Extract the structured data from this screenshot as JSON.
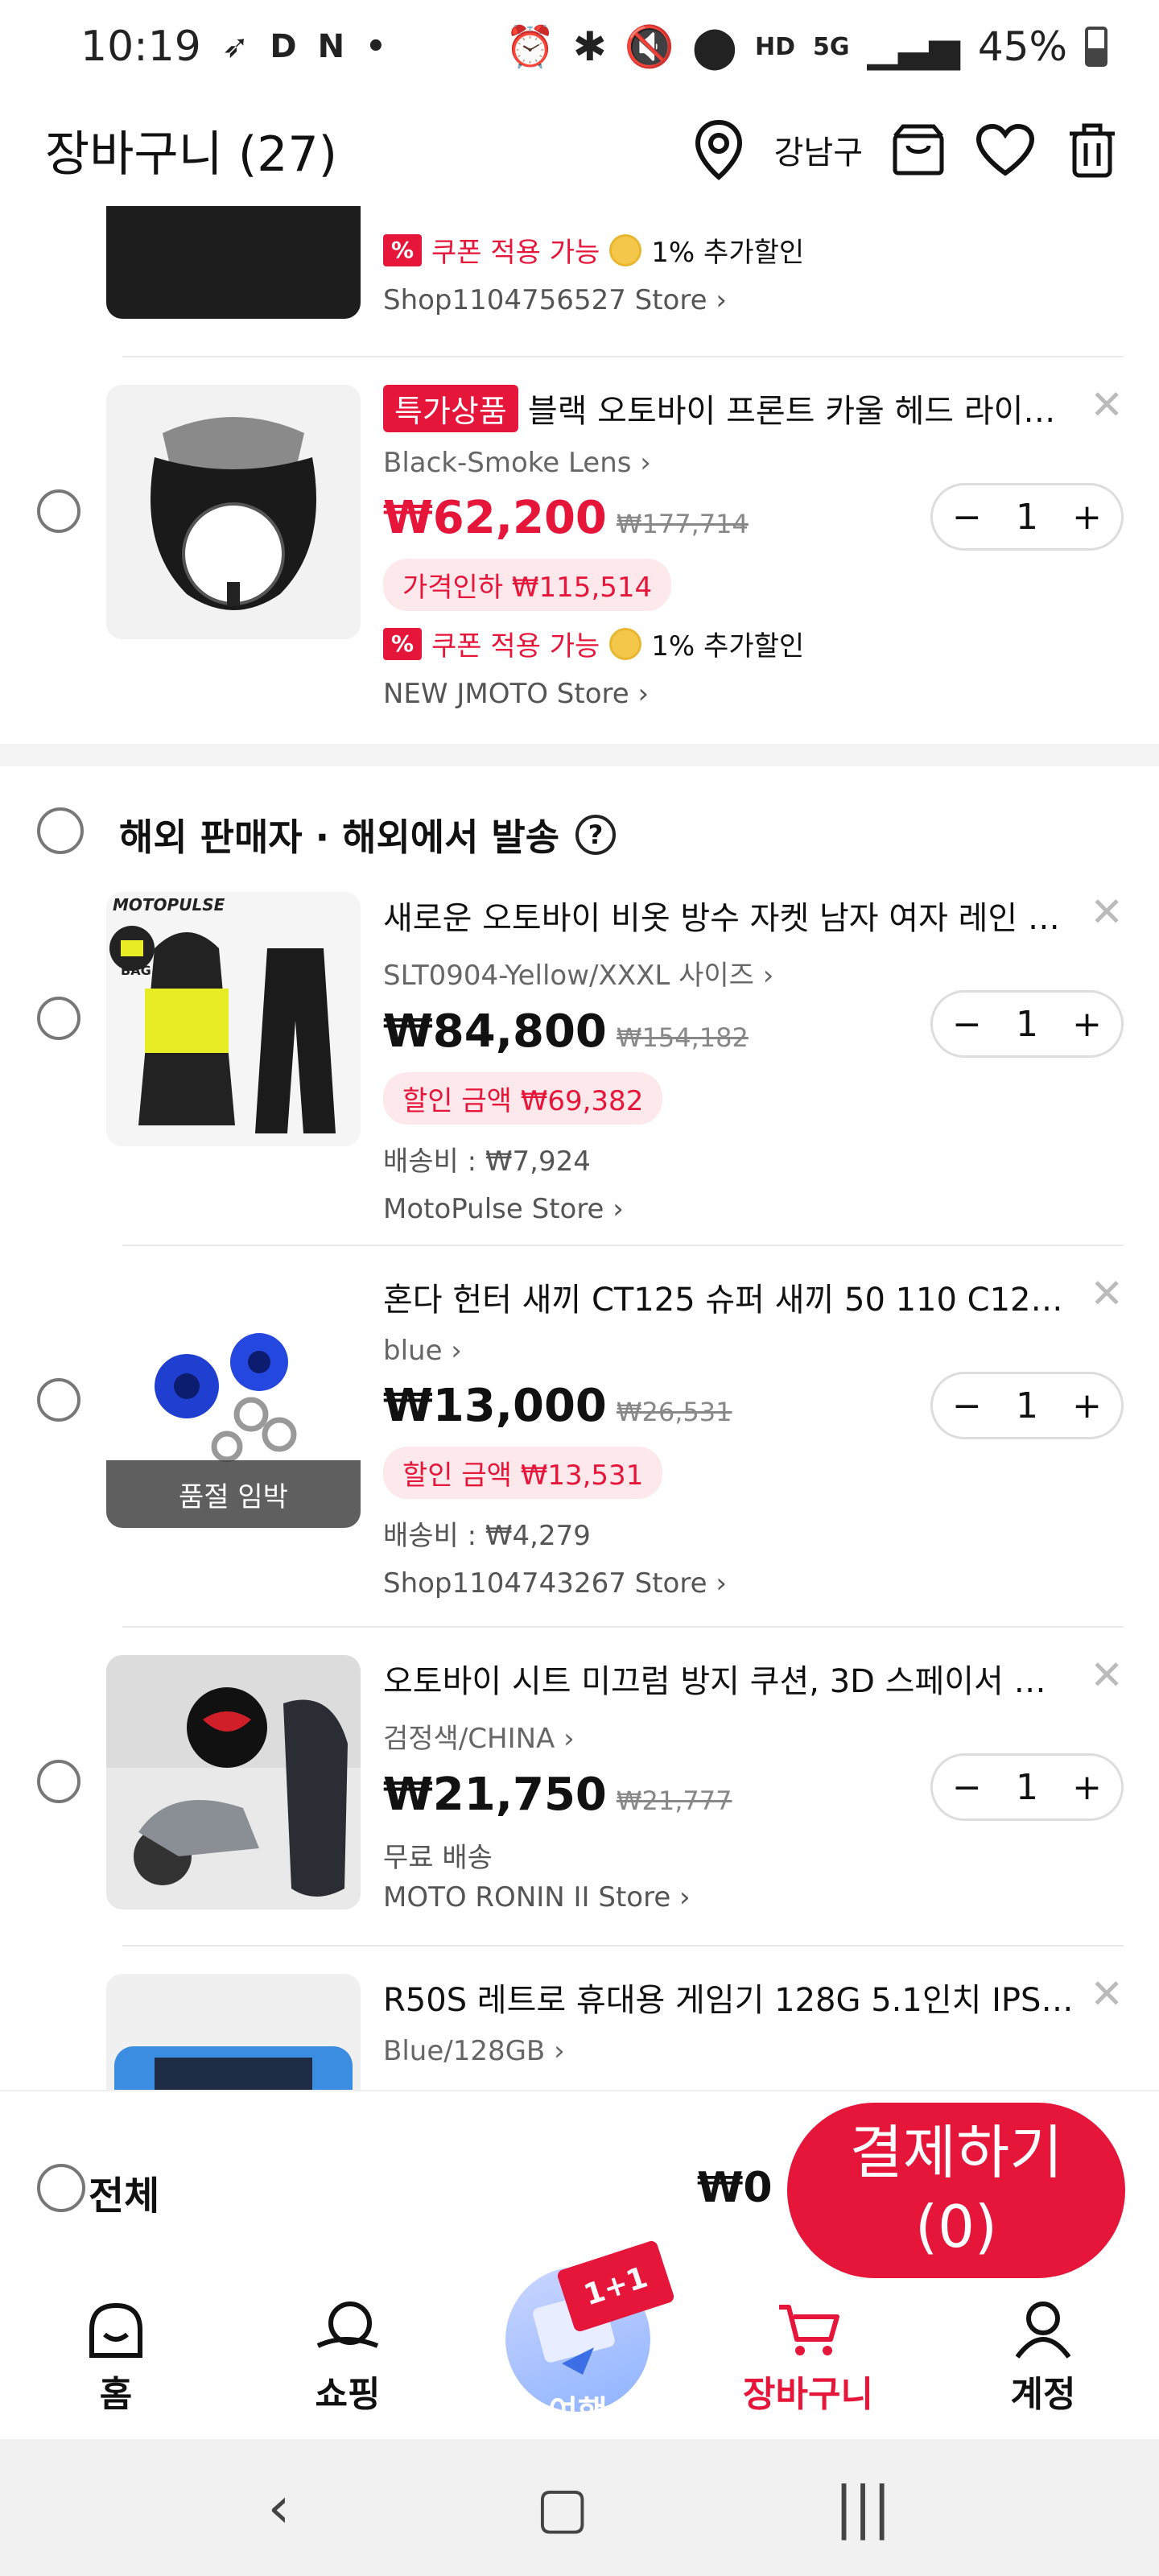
{
  "status_bar": {
    "time": "10:19",
    "battery": "45%",
    "icons": [
      "alarm-icon",
      "bluetooth-icon",
      "mute-icon",
      "location-icon",
      "hd-voice-icon",
      "5g-icon",
      "signal-icon",
      "battery-icon"
    ]
  },
  "header": {
    "title": "장바구니 (27)",
    "location_label": "강남구"
  },
  "items_top": [
    {
      "coupon_label": "쿠폰 적용 가능",
      "extra_discount": "1% 추가할인",
      "store": "Shop1104756527 Store"
    },
    {
      "badge": "특가상품",
      "name": "블랙 오토바이 프론트 카울 헤드 라이트 ...",
      "option": "Black-Smoke Lens",
      "price": "₩62,200",
      "original_price": "₩177,714",
      "discount_pill": "가격인하 ₩115,514",
      "coupon_label": "쿠폰 적용 가능",
      "extra_discount": "1% 추가할인",
      "store": "NEW JMOTO Store",
      "quantity": "1"
    }
  ],
  "overseas_section": {
    "title": "해외 판매자 · 해외에서 발송",
    "help_icon": "?"
  },
  "overseas_items": [
    {
      "name": "새로운 오토바이 비옷 방수 자켓 남자 여자 레인 커버 ...",
      "option": "SLT0904-Yellow/XXXL 사이즈",
      "price": "₩84,800",
      "original_price": "₩154,182",
      "discount_pill": "할인 금액 ₩69,382",
      "shipping": "배송비 : ₩7,924",
      "store": "MotoPulse Store",
      "quantity": "1",
      "thumb_brand": "MOTOPULSE",
      "thumb_bag": "BAG"
    },
    {
      "name": "혼다 헌터 새끼 CT125 슈퍼 새끼 50 110 C125 체...",
      "option": "blue",
      "price": "₩13,000",
      "original_price": "₩26,531",
      "discount_pill": "할인 금액 ₩13,531",
      "shipping": "배송비 : ₩4,279",
      "store": "Shop1104743267 Store",
      "quantity": "1",
      "soldout_label": "품절 임박"
    },
    {
      "name": "오토바이 시트 미끄럼 방지 쿠션, 3D 스페이서 메쉬 ...",
      "option": "검정색/CHINA",
      "price": "₩21,750",
      "original_price": "₩21,777",
      "shipping": "무료 배송",
      "store": "MOTO RONIN II Store",
      "quantity": "1"
    },
    {
      "name": "R50S 레트로 휴대용 게임기 128G 5.1인치 IPS 화면...",
      "option": "Blue/128GB"
    }
  ],
  "checkout": {
    "select_all_label": "전체",
    "total": "₩0",
    "button_label_line1": "결제하기",
    "button_label_line2": "(0)"
  },
  "bottom_nav": {
    "home": "홈",
    "shopping": "쇼핑",
    "travel": "여행",
    "travel_promo": "1+1",
    "cart": "장바구니",
    "account": "계정"
  },
  "colors": {
    "accent": "#e6153a",
    "pill_bg": "#fde9ec"
  }
}
